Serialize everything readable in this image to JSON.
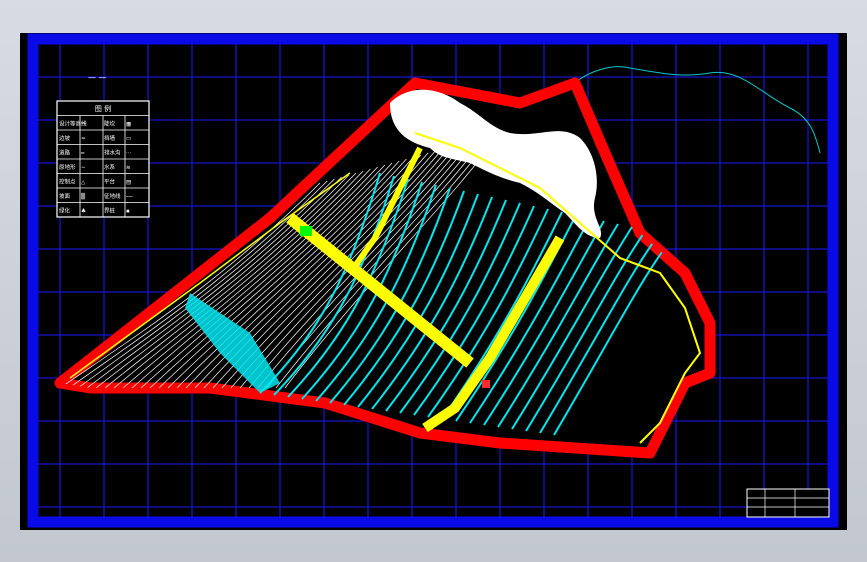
{
  "viewport": {
    "background_color": "#000000",
    "frame_color": "#0a0ae6",
    "grid_color": "#1a1aff"
  },
  "drawing": {
    "boundary_color": "#ff0000",
    "inner_boundary_color": "#ffff00",
    "road_color": "#ffff00",
    "contour_color": "#ffffff",
    "water_contour_color": "#00e5ee",
    "rock_area_color": "#ffffff",
    "green_marker_color": "#00ff00",
    "outside_contour_color": "#00c8c8",
    "title_text": "—  —"
  },
  "legend": {
    "title": "图 例",
    "rows": [
      [
        "设计等高线",
        "〰",
        "陡坎",
        "▦"
      ],
      [
        "边坡",
        "≈",
        "挡墙",
        "▭"
      ],
      [
        "道路",
        "═",
        "排水沟",
        "⋯"
      ],
      [
        "原地形",
        "∼",
        "水系",
        "≋"
      ],
      [
        "控制点",
        "△",
        "平台",
        "▤"
      ],
      [
        "坡面",
        "▒",
        "征地线",
        "──"
      ],
      [
        "绿化",
        "♣",
        "界桩",
        "▪"
      ]
    ]
  },
  "title_block": {
    "label": "—"
  }
}
